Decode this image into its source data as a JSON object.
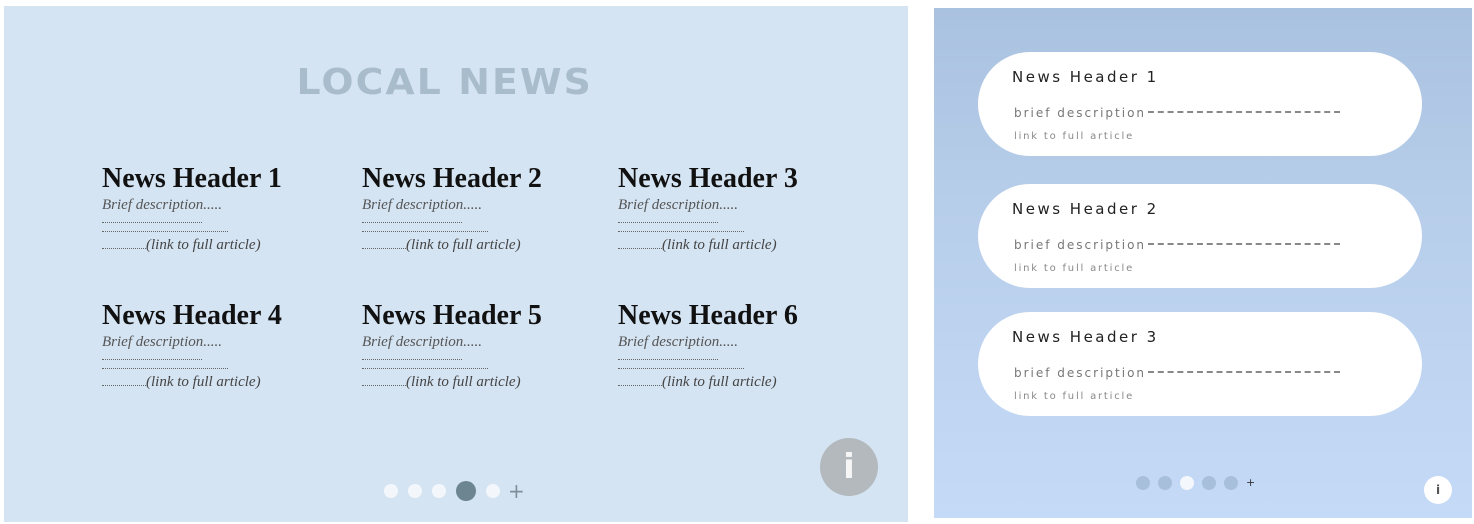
{
  "left": {
    "title": "LOCAL NEWS",
    "news": [
      {
        "header": "News Header 1",
        "description": "Brief description.....",
        "link": "(link to full article)"
      },
      {
        "header": "News Header 2",
        "description": "Brief description.....",
        "link": "(link to full article)"
      },
      {
        "header": "News Header 3",
        "description": "Brief description.....",
        "link": "(link to full article)"
      },
      {
        "header": "News Header 4",
        "description": "Brief description.....",
        "link": "(link to full article)"
      },
      {
        "header": "News Header 5",
        "description": "Brief description.....",
        "link": "(link to full article)"
      },
      {
        "header": "News Header 6",
        "description": "Brief description.....",
        "link": "(link to full article)"
      }
    ],
    "pager": {
      "page_count": 5,
      "active_index": 3,
      "add_icon": "plus-icon"
    },
    "info_icon": "info-icon"
  },
  "right": {
    "cards": [
      {
        "header": "News Header 1",
        "description": "brief description",
        "link": "link to full article"
      },
      {
        "header": "News Header 2",
        "description": "brief description",
        "link": "link to full article"
      },
      {
        "header": "News Header 3",
        "description": "brief description",
        "link": "link to full article"
      }
    ],
    "pager": {
      "page_count": 5,
      "active_index": 2,
      "add_icon": "plus-icon"
    },
    "info_icon": "info-icon"
  },
  "colors": {
    "left_background": "#d5e4f3",
    "title_color": "#a9bccb",
    "right_background_top": "#a9c2e0",
    "right_background_bottom": "#c5daf7",
    "card_background": "#ffffff",
    "left_active_dot": "#6c8590",
    "info_button": "#b3b9bd"
  }
}
